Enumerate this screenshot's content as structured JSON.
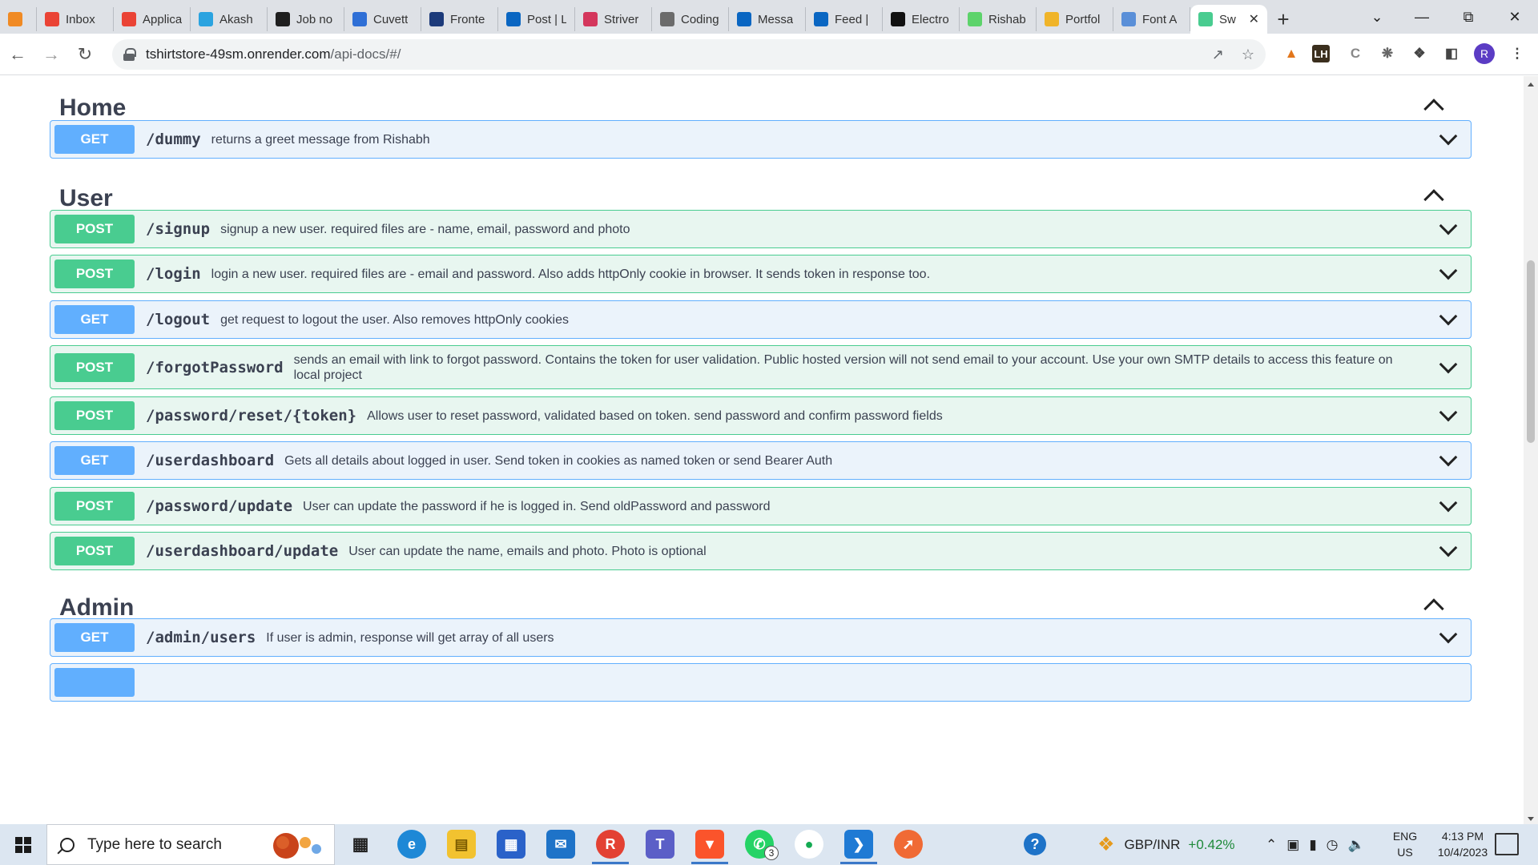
{
  "browser": {
    "tabs": [
      {
        "label": "",
        "color": "#f08a24",
        "icon": "firefox-like-icon"
      },
      {
        "label": "Inbox",
        "color": "#ea4335",
        "icon": "gmail-icon"
      },
      {
        "label": "Applica",
        "color": "#ea4335",
        "icon": "gmail-icon"
      },
      {
        "label": "Akash",
        "color": "#2aa3e0",
        "icon": "telegram-icon"
      },
      {
        "label": "Job no",
        "color": "#1f1f1f",
        "icon": "job-icon"
      },
      {
        "label": "Cuvett",
        "color": "#2f6fd6",
        "icon": "cuvette-icon"
      },
      {
        "label": "Fronte",
        "color": "#1c3a7a",
        "icon": "unstop-icon"
      },
      {
        "label": "Post | L",
        "color": "#0a66c2",
        "icon": "linkedin-icon"
      },
      {
        "label": "Striver",
        "color": "#d4365c",
        "icon": "striver-icon"
      },
      {
        "label": "Coding",
        "color": "#6b6b6b",
        "icon": "coding-icon"
      },
      {
        "label": "Messa",
        "color": "#0a66c2",
        "icon": "linkedin-icon"
      },
      {
        "label": "Feed |",
        "color": "#0a66c2",
        "icon": "linkedin-icon"
      },
      {
        "label": "Electro",
        "color": "#111111",
        "icon": "amazon-icon"
      },
      {
        "label": "Rishab",
        "color": "#5dd36b",
        "icon": "replit-icon"
      },
      {
        "label": "Portfol",
        "color": "#f0b429",
        "icon": "portfolio-icon"
      },
      {
        "label": "Font A",
        "color": "#5a8fd8",
        "icon": "flag-icon"
      },
      {
        "label": "Sw",
        "color": "#49cc90",
        "icon": "swagger-icon",
        "active": true
      }
    ],
    "url_host": "tshirtstore-49sm.onrender.com",
    "url_path": "/api-docs/#/",
    "extensions": [
      "fox-icon",
      "LH",
      "C",
      "bug-icon",
      "puzzle-icon",
      "sidepanel-icon"
    ],
    "avatar_letter": "R"
  },
  "sections": [
    {
      "title": "Home",
      "ops": [
        {
          "method": "GET",
          "path": "/dummy",
          "desc": "returns a greet message from Rishabh"
        }
      ]
    },
    {
      "title": "User",
      "ops": [
        {
          "method": "POST",
          "path": "/signup",
          "desc": "signup a new user. required files are - name, email, password and photo"
        },
        {
          "method": "POST",
          "path": "/login",
          "desc": "login a new user. required files are - email and password. Also adds httpOnly cookie in browser. It sends token in response too."
        },
        {
          "method": "GET",
          "path": "/logout",
          "desc": "get request to logout the user. Also removes httpOnly cookies"
        },
        {
          "method": "POST",
          "path": "/forgotPassword",
          "desc": "sends an email with link to forgot password. Contains the token for user validation. Public hosted version will not send email to your account. Use your own SMTP details to access this feature on local project"
        },
        {
          "method": "POST",
          "path": "/password/reset/{token}",
          "desc": "Allows user to reset password, validated based on token. send password and confirm password fields"
        },
        {
          "method": "GET",
          "path": "/userdashboard",
          "desc": "Gets all details about logged in user. Send token in cookies as named token or send Bearer Auth"
        },
        {
          "method": "POST",
          "path": "/password/update",
          "desc": "User can update the password if he is logged in. Send oldPassword and password"
        },
        {
          "method": "POST",
          "path": "/userdashboard/update",
          "desc": "User can update the name, emails and photo. Photo is optional"
        }
      ]
    },
    {
      "title": "Admin",
      "ops": [
        {
          "method": "GET",
          "path": "/admin/users",
          "desc": "If user is admin, response will get array of all users"
        }
      ]
    }
  ],
  "taskbar": {
    "search_placeholder": "Type here to search",
    "whatsapp_badge": "3",
    "ticker_symbol": "GBP/INR",
    "ticker_change": "+0.42%",
    "lang_top": "ENG",
    "lang_bottom": "US",
    "time": "4:13 PM",
    "date": "10/4/2023"
  },
  "colors": {
    "get": "#61affe",
    "post": "#49cc90",
    "ticker_positive": "#1f8a3a"
  }
}
